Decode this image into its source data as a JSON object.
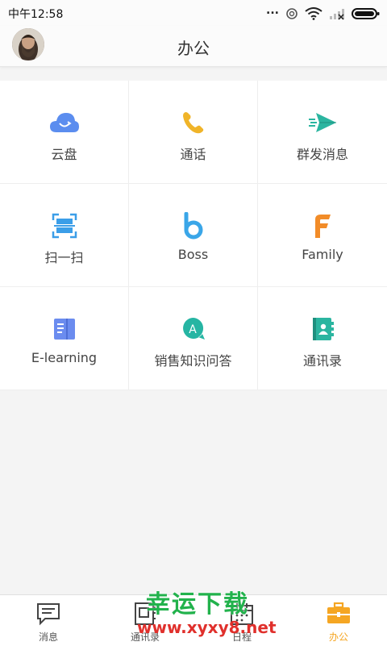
{
  "status_bar": {
    "time": "中午12:58",
    "dots": "..."
  },
  "header": {
    "title": "办公"
  },
  "grid_items": [
    {
      "label": "云盘",
      "icon": "cloud-icon",
      "color": "#5b8def"
    },
    {
      "label": "通话",
      "icon": "phone-icon",
      "color": "#f0b429"
    },
    {
      "label": "群发消息",
      "icon": "send-icon",
      "color": "#2bb5a0"
    },
    {
      "label": "扫一扫",
      "icon": "scan-icon",
      "color": "#3b9ee8"
    },
    {
      "label": "Boss",
      "icon": "boss-b-icon",
      "color": "#3aa6e8"
    },
    {
      "label": "Family",
      "icon": "family-f-icon",
      "color": "#f28c28"
    },
    {
      "label": "E-learning",
      "icon": "book-icon",
      "color": "#6b8cef"
    },
    {
      "label": "销售知识问答",
      "icon": "qa-chat-icon",
      "color": "#26b5a3"
    },
    {
      "label": "通讯录",
      "icon": "contacts-icon",
      "color": "#2bb5a0"
    }
  ],
  "tab_bar": {
    "tabs": [
      {
        "label": "消息",
        "icon": "message-icon"
      },
      {
        "label": "通讯录",
        "icon": "contacts-book-icon"
      },
      {
        "label": "日程",
        "icon": "calendar-icon"
      },
      {
        "label": "办公",
        "icon": "briefcase-icon",
        "active": true
      }
    ],
    "active_color": "#f5a623"
  },
  "watermark": {
    "line1": "幸运下载",
    "line2": "www.xyxy8.net"
  }
}
